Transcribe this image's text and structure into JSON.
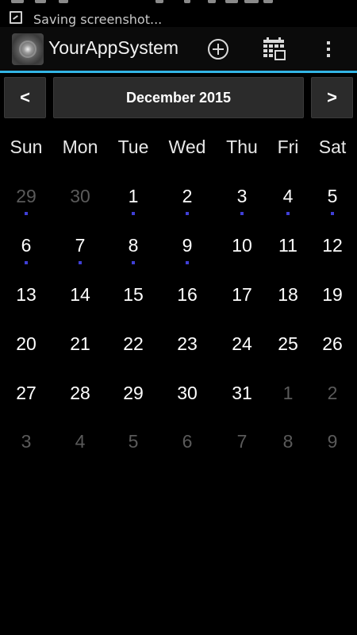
{
  "status_bar": {
    "notification_text": "Saving screenshot...",
    "notification_icon": "screenshot-icon"
  },
  "action_bar": {
    "title": "YourAppSystem",
    "app_icon": "app-logo-icon",
    "actions": [
      "add-icon",
      "calendar-icon",
      "overflow-menu-icon"
    ],
    "accent_color": "#33b5e5"
  },
  "calendar": {
    "prev_label": "<",
    "next_label": ">",
    "month_label": "December 2015",
    "weekdays": [
      "Sun",
      "Mon",
      "Tue",
      "Wed",
      "Thu",
      "Fri",
      "Sat"
    ],
    "event_dot_color": "#3f3fd6",
    "weeks": [
      [
        {
          "d": "29",
          "cur": false,
          "dot": true
        },
        {
          "d": "30",
          "cur": false,
          "dot": false
        },
        {
          "d": "1",
          "cur": true,
          "dot": true
        },
        {
          "d": "2",
          "cur": true,
          "dot": true
        },
        {
          "d": "3",
          "cur": true,
          "dot": true
        },
        {
          "d": "4",
          "cur": true,
          "dot": true
        },
        {
          "d": "5",
          "cur": true,
          "dot": true
        }
      ],
      [
        {
          "d": "6",
          "cur": true,
          "dot": true
        },
        {
          "d": "7",
          "cur": true,
          "dot": true
        },
        {
          "d": "8",
          "cur": true,
          "dot": true
        },
        {
          "d": "9",
          "cur": true,
          "dot": true
        },
        {
          "d": "10",
          "cur": true,
          "dot": false
        },
        {
          "d": "11",
          "cur": true,
          "dot": false
        },
        {
          "d": "12",
          "cur": true,
          "dot": false
        }
      ],
      [
        {
          "d": "13",
          "cur": true,
          "dot": false
        },
        {
          "d": "14",
          "cur": true,
          "dot": false
        },
        {
          "d": "15",
          "cur": true,
          "dot": false
        },
        {
          "d": "16",
          "cur": true,
          "dot": false
        },
        {
          "d": "17",
          "cur": true,
          "dot": false
        },
        {
          "d": "18",
          "cur": true,
          "dot": false
        },
        {
          "d": "19",
          "cur": true,
          "dot": false
        }
      ],
      [
        {
          "d": "20",
          "cur": true,
          "dot": false
        },
        {
          "d": "21",
          "cur": true,
          "dot": false
        },
        {
          "d": "22",
          "cur": true,
          "dot": false
        },
        {
          "d": "23",
          "cur": true,
          "dot": false
        },
        {
          "d": "24",
          "cur": true,
          "dot": false
        },
        {
          "d": "25",
          "cur": true,
          "dot": false
        },
        {
          "d": "26",
          "cur": true,
          "dot": false
        }
      ],
      [
        {
          "d": "27",
          "cur": true,
          "dot": false
        },
        {
          "d": "28",
          "cur": true,
          "dot": false
        },
        {
          "d": "29",
          "cur": true,
          "dot": false
        },
        {
          "d": "30",
          "cur": true,
          "dot": false
        },
        {
          "d": "31",
          "cur": true,
          "dot": false
        },
        {
          "d": "1",
          "cur": false,
          "dot": false
        },
        {
          "d": "2",
          "cur": false,
          "dot": false
        }
      ],
      [
        {
          "d": "3",
          "cur": false,
          "dot": false
        },
        {
          "d": "4",
          "cur": false,
          "dot": false
        },
        {
          "d": "5",
          "cur": false,
          "dot": false
        },
        {
          "d": "6",
          "cur": false,
          "dot": false
        },
        {
          "d": "7",
          "cur": false,
          "dot": false
        },
        {
          "d": "8",
          "cur": false,
          "dot": false
        },
        {
          "d": "9",
          "cur": false,
          "dot": false
        }
      ]
    ]
  }
}
